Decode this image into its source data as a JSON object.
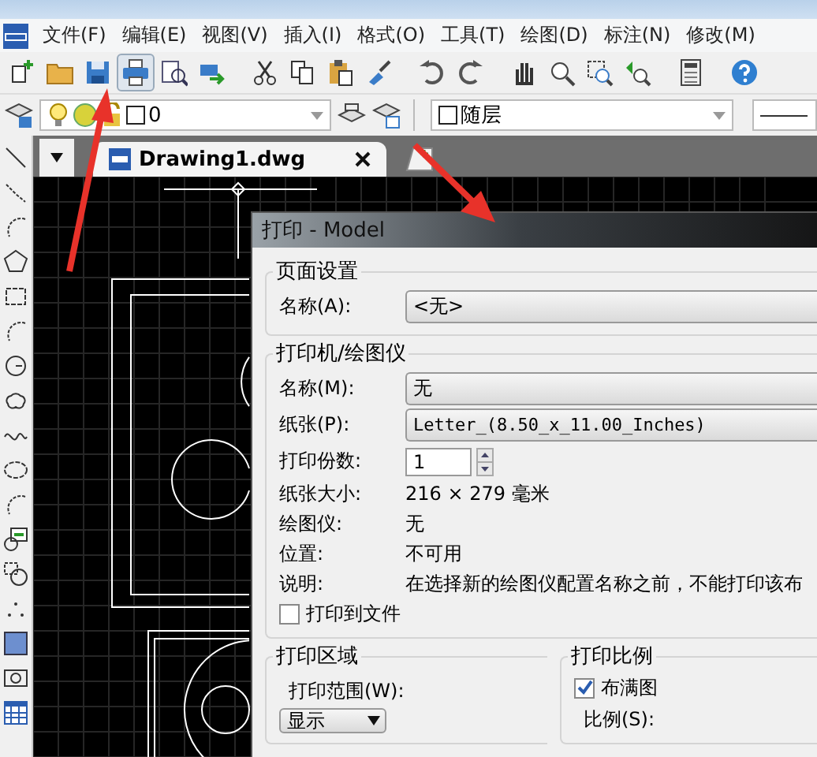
{
  "menu_bar": {
    "items": [
      "文件(F)",
      "编辑(E)",
      "视图(V)",
      "插入(I)",
      "格式(O)",
      "工具(T)",
      "绘图(D)",
      "标注(N)",
      "修改(M)"
    ]
  },
  "toolbar": {
    "buttons": [
      {
        "kind": "new",
        "selected": false
      },
      {
        "kind": "open",
        "selected": false
      },
      {
        "kind": "save",
        "selected": false
      },
      {
        "kind": "print",
        "selected": true
      },
      {
        "kind": "preview",
        "selected": false
      },
      {
        "kind": "publish",
        "selected": false
      },
      {
        "kind": "cut",
        "selected": false
      },
      {
        "kind": "copy",
        "selected": false
      },
      {
        "kind": "paste",
        "selected": false
      },
      {
        "kind": "brush",
        "selected": false
      },
      {
        "kind": "undo",
        "selected": false
      },
      {
        "kind": "redo",
        "selected": false
      },
      {
        "kind": "pan",
        "selected": false
      },
      {
        "kind": "zoom",
        "selected": false
      },
      {
        "kind": "zoom-window",
        "selected": false
      },
      {
        "kind": "zoom-previous",
        "selected": false
      },
      {
        "kind": "calculator",
        "selected": false
      },
      {
        "kind": "help",
        "selected": false
      }
    ]
  },
  "layer_bar": {
    "layer_value": "0",
    "color_value": "随层"
  },
  "tabs": [
    {
      "label": "Drawing1.dwg",
      "selected": true
    }
  ],
  "dialog": {
    "title": "打印 - Model",
    "page_setup": {
      "heading": "页面设置",
      "name_label": "名称(A):",
      "name_value": "<无>"
    },
    "printer": {
      "heading": "打印机/绘图仪",
      "name_label": "名称(M):",
      "name_value": "无",
      "paper_label": "纸张(P):",
      "paper_value": "Letter_(8.50_x_11.00_Inches)",
      "copies_label": "打印份数:",
      "copies_value": "1",
      "info": [
        {
          "label": "纸张大小:",
          "value": "216 × 279  毫米"
        },
        {
          "label": "绘图仪:",
          "value": "无"
        },
        {
          "label": "位置:",
          "value": "不可用"
        },
        {
          "label": "说明:",
          "value": "在选择新的绘图仪配置名称之前，不能打印该布"
        }
      ],
      "print_to_file": {
        "label": "打印到文件",
        "checked": false
      }
    },
    "print_area": {
      "heading": "打印区域",
      "range_label": "打印范围(W):",
      "range_value": "显示"
    },
    "print_scale": {
      "heading": "打印比例",
      "fit": {
        "label": "布满图",
        "checked": true
      },
      "scale_label": "比例(S):"
    }
  }
}
